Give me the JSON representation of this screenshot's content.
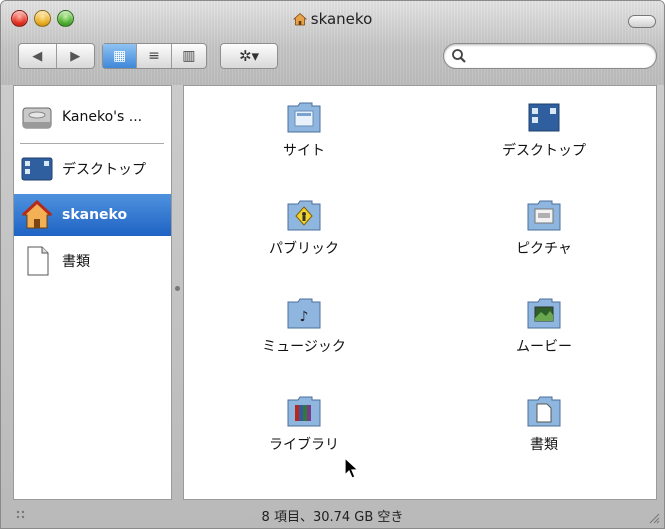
{
  "window": {
    "title": "skaneko"
  },
  "toolbar": {
    "back": "◀",
    "forward": "▶",
    "view_icon": "▦",
    "view_list": "≡",
    "view_column": "▥",
    "action": "✲▾",
    "search_value": ""
  },
  "sidebar": {
    "items": [
      {
        "label": "Kaneko's ...",
        "icon": "hard-drive-icon"
      },
      {
        "label": "デスクトップ",
        "icon": "desktop-icon"
      },
      {
        "label": "skaneko",
        "icon": "home-icon",
        "selected": true
      },
      {
        "label": "書類",
        "icon": "document-icon"
      }
    ]
  },
  "folders": [
    {
      "label": "サイト",
      "icon": "sites-folder-icon"
    },
    {
      "label": "デスクトップ",
      "icon": "desktop-folder-icon"
    },
    {
      "label": "パブリック",
      "icon": "public-folder-icon"
    },
    {
      "label": "ピクチャ",
      "icon": "pictures-folder-icon"
    },
    {
      "label": "ミュージック",
      "icon": "music-folder-icon"
    },
    {
      "label": "ムービー",
      "icon": "movies-folder-icon"
    },
    {
      "label": "ライブラリ",
      "icon": "library-folder-icon"
    },
    {
      "label": "書類",
      "icon": "documents-folder-icon"
    }
  ],
  "status": {
    "text": "8 項目、30.74 GB 空き"
  },
  "colors": {
    "selection": "#2f74d0",
    "folder": "#9ec3e6"
  }
}
